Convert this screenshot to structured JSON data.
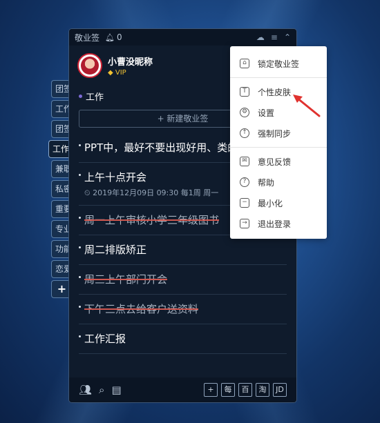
{
  "window": {
    "title": "敬业签",
    "bell_count": "0"
  },
  "profile": {
    "name": "小曹没昵称",
    "badge": "VIP"
  },
  "side_tabs": [
    "团签",
    "工作",
    "团签",
    "工作",
    "兼职",
    "私密",
    "重要",
    "专业",
    "功能",
    "恋爱",
    "+"
  ],
  "category": "工作",
  "new_note_label": "+ 新建敬业签",
  "notes": [
    {
      "text": "PPT中，最好不要出现好用、类的宣传词。",
      "meta": "",
      "done": false
    },
    {
      "text": "上午十点开会",
      "meta": "2019年12月09日 09:30 每1周 周一",
      "done": false
    },
    {
      "text": "周一上午审核小学三年级图书",
      "meta": "",
      "done": true
    },
    {
      "text": "周二排版矫正",
      "meta": "",
      "done": false
    },
    {
      "text": "周三上午部门开会",
      "meta": "",
      "done": true
    },
    {
      "text": "下午三点去给客户送资料",
      "meta": "",
      "done": true
    },
    {
      "text": "工作汇报",
      "meta": "",
      "done": false
    }
  ],
  "bottom_right_buttons": [
    "+",
    "每",
    "百",
    "淘",
    "JD"
  ],
  "menu": {
    "items": [
      {
        "label": "锁定敬业签",
        "icon": "lock-icon",
        "glyph": "⌂"
      },
      {
        "label": "个性皮肤",
        "icon": "shirt-icon",
        "glyph": "T"
      },
      {
        "label": "设置",
        "icon": "gear-icon",
        "glyph": "⚙"
      },
      {
        "label": "强制同步",
        "icon": "sync-icon",
        "glyph": "↑"
      },
      {
        "label": "意见反馈",
        "icon": "mail-icon",
        "glyph": "✉"
      },
      {
        "label": "帮助",
        "icon": "help-icon",
        "glyph": "?"
      },
      {
        "label": "最小化",
        "icon": "minimize-icon",
        "glyph": "−"
      },
      {
        "label": "退出登录",
        "icon": "logout-icon",
        "glyph": "→"
      }
    ]
  },
  "colors": {
    "accent_arrow": "#e0322f",
    "strike": "#d0574f",
    "vip_gold": "#f1c232"
  }
}
